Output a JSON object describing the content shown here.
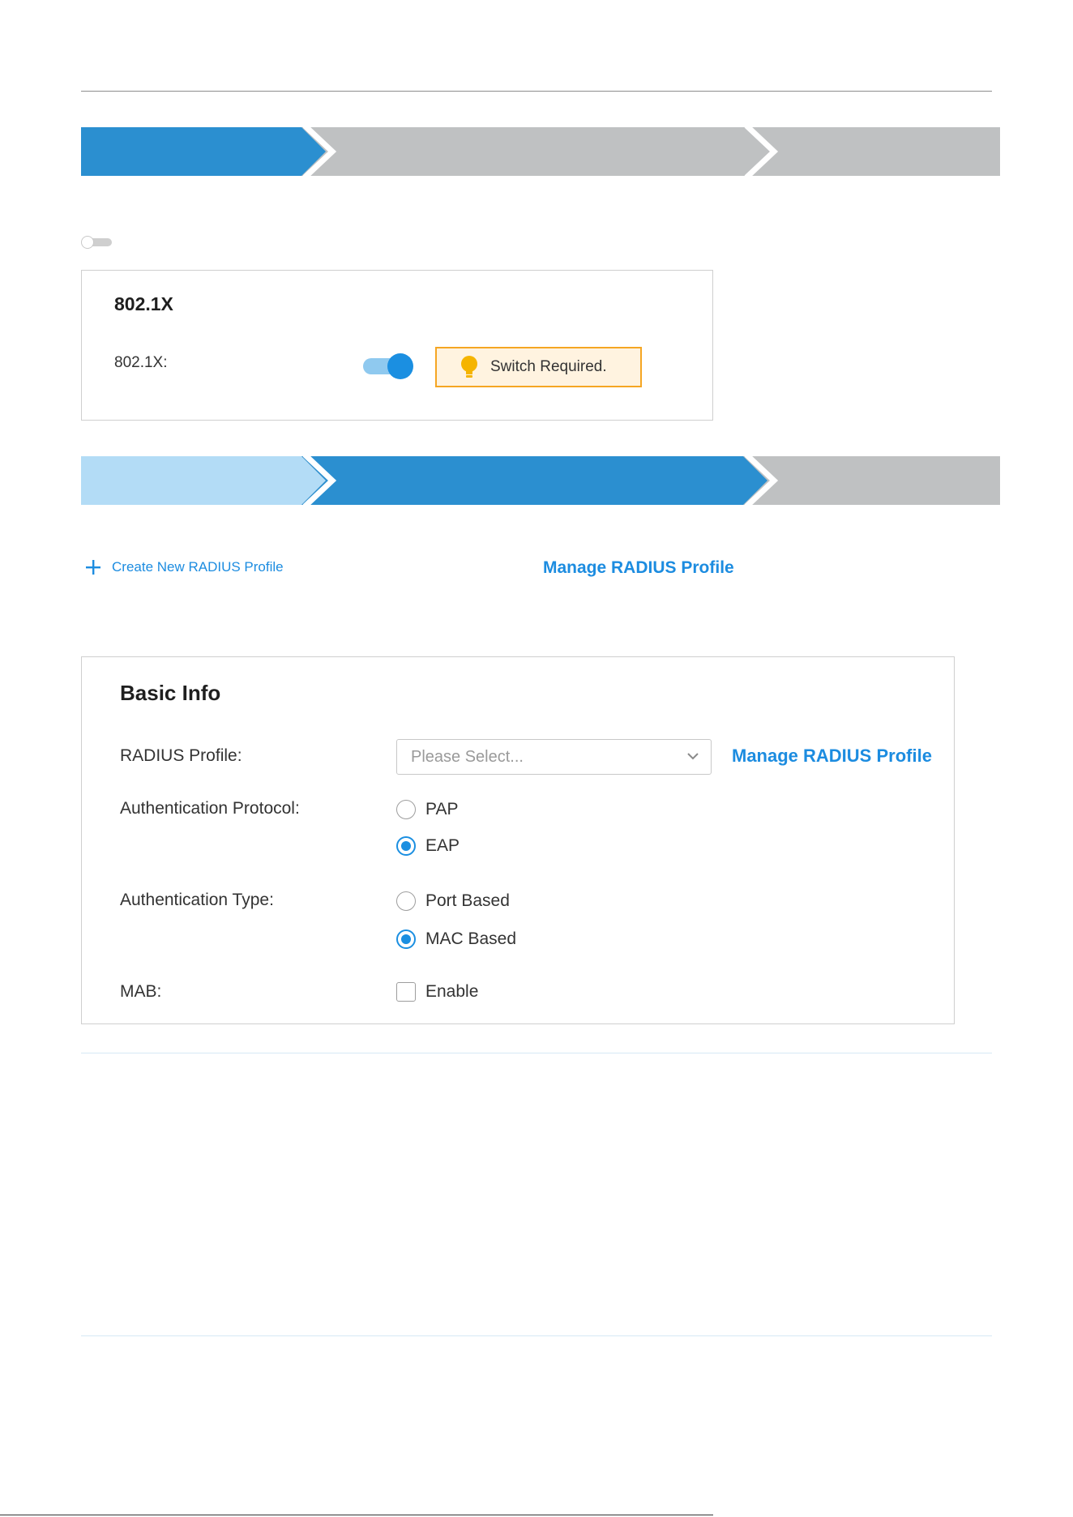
{
  "section_8021x": {
    "title": "802.1X",
    "field_label": "802.1X:",
    "toggle_state": "on",
    "note": "Switch Required."
  },
  "actions": {
    "create_profile": "Create New RADIUS Profile",
    "manage_profile": "Manage RADIUS Profile"
  },
  "basic_info": {
    "title": "Basic Info",
    "radius_profile": {
      "label": "RADIUS Profile:",
      "placeholder": "Please Select...",
      "manage_link": "Manage RADIUS Profile"
    },
    "auth_protocol": {
      "label": "Authentication Protocol:",
      "options": [
        "PAP",
        "EAP"
      ],
      "selected": "EAP"
    },
    "auth_type": {
      "label": "Authentication Type:",
      "options": [
        "Port Based",
        "MAC Based"
      ],
      "selected": "MAC Based"
    },
    "mab": {
      "label": "MAB:",
      "option": "Enable",
      "checked": false
    }
  },
  "colors": {
    "accent": "#1b8fe1",
    "step_active": "#2b8fd0",
    "step_done": "#b3dcf6",
    "step_pending": "#bfc1c2",
    "note_border": "#f5a623",
    "note_bg": "#fff3e0"
  },
  "icons": {
    "note": "lightbulb-icon",
    "create": "plus-icon",
    "select": "chevron-down-icon"
  }
}
